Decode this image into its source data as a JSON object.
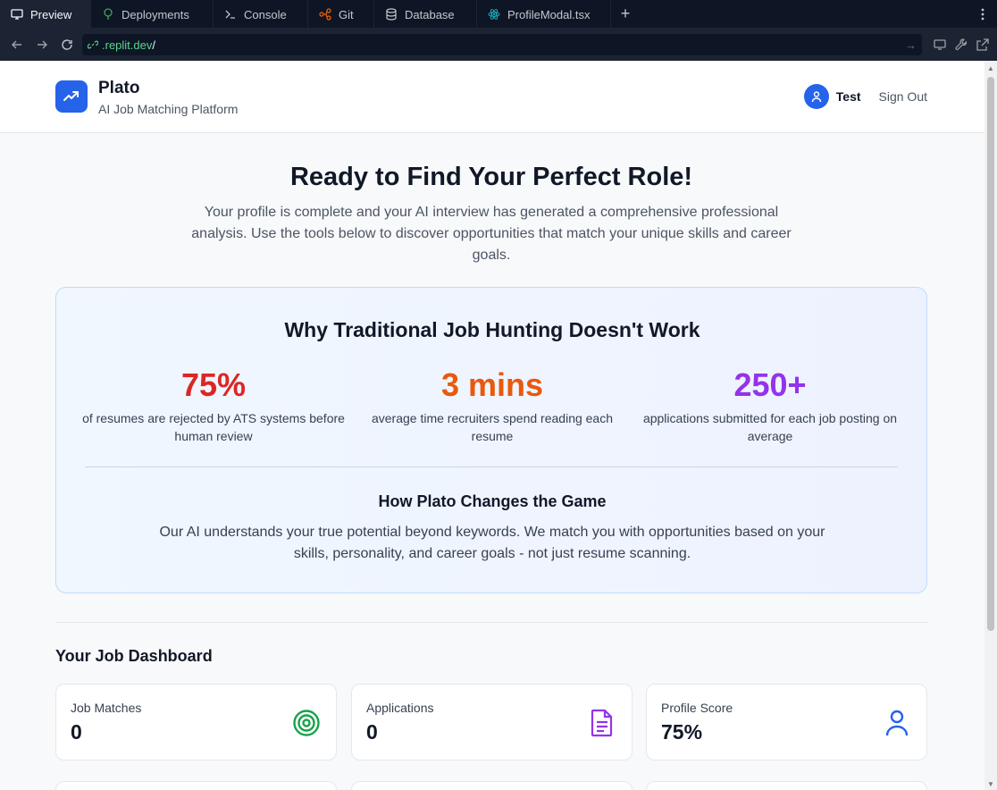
{
  "ide": {
    "tabs": [
      {
        "label": "Preview",
        "icon": "monitor-icon",
        "active": true
      },
      {
        "label": "Deployments",
        "icon": "deploy-icon"
      },
      {
        "label": "Console",
        "icon": "terminal-icon"
      },
      {
        "label": "Git",
        "icon": "git-icon"
      },
      {
        "label": "Database",
        "icon": "database-icon"
      },
      {
        "label": "ProfileModal.tsx",
        "icon": "react-icon"
      }
    ],
    "url_domain": ".replit.dev",
    "url_path": "/"
  },
  "header": {
    "brand": "Plato",
    "tagline": "AI Job Matching Platform",
    "user_name": "Test",
    "signout_label": "Sign Out"
  },
  "hero": {
    "title": "Ready to Find Your Perfect Role!",
    "subtitle": "Your profile is complete and your AI interview has generated a comprehensive professional analysis. Use the tools below to discover opportunities that match your unique skills and career goals."
  },
  "why": {
    "title": "Why Traditional Job Hunting Doesn't Work",
    "stats": [
      {
        "value": "75%",
        "label": "of resumes are rejected by ATS systems before human review",
        "color": "#dc2626"
      },
      {
        "value": "3 mins",
        "label": "average time recruiters spend reading each resume",
        "color": "#ea580c"
      },
      {
        "value": "250+",
        "label": "applications submitted for each job posting on average",
        "color": "#9333ea"
      }
    ],
    "how_title": "How Plato Changes the Game",
    "how_text": "Our AI understands your true potential beyond keywords. We match you with opportunities based on your skills, personality, and career goals - not just resume scanning."
  },
  "dashboard": {
    "title": "Your Job Dashboard",
    "cards": [
      {
        "label": "Job Matches",
        "value": "0",
        "icon": "target-icon",
        "color": "#16a34a"
      },
      {
        "label": "Applications",
        "value": "0",
        "icon": "document-icon",
        "color": "#9333ea"
      },
      {
        "label": "Profile Score",
        "value": "75%",
        "icon": "user-icon",
        "color": "#2563eb"
      }
    ]
  }
}
